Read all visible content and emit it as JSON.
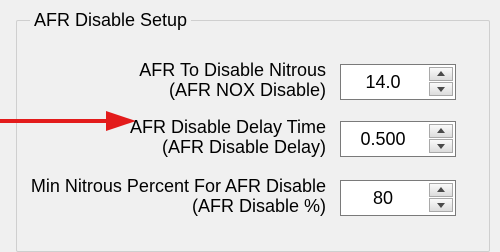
{
  "group": {
    "title": "AFR Disable Setup"
  },
  "fields": [
    {
      "label_line1": "AFR To Disable Nitrous",
      "label_line2": "(AFR NOX Disable)",
      "value": "14.0"
    },
    {
      "label_line1": "AFR Disable Delay Time",
      "label_line2": "(AFR Disable Delay)",
      "value": "0.500"
    },
    {
      "label_line1": "Min Nitrous Percent For AFR Disable",
      "label_line2": "(AFR Disable %)",
      "value": "80"
    }
  ],
  "icons": {
    "arrow": "red-arrow-icon",
    "spin_up": "triangle-up-icon",
    "spin_down": "triangle-down-icon"
  },
  "colors": {
    "arrow": "#e31b1b",
    "background": "#f0f0f0",
    "border": "#7a7a7a"
  }
}
